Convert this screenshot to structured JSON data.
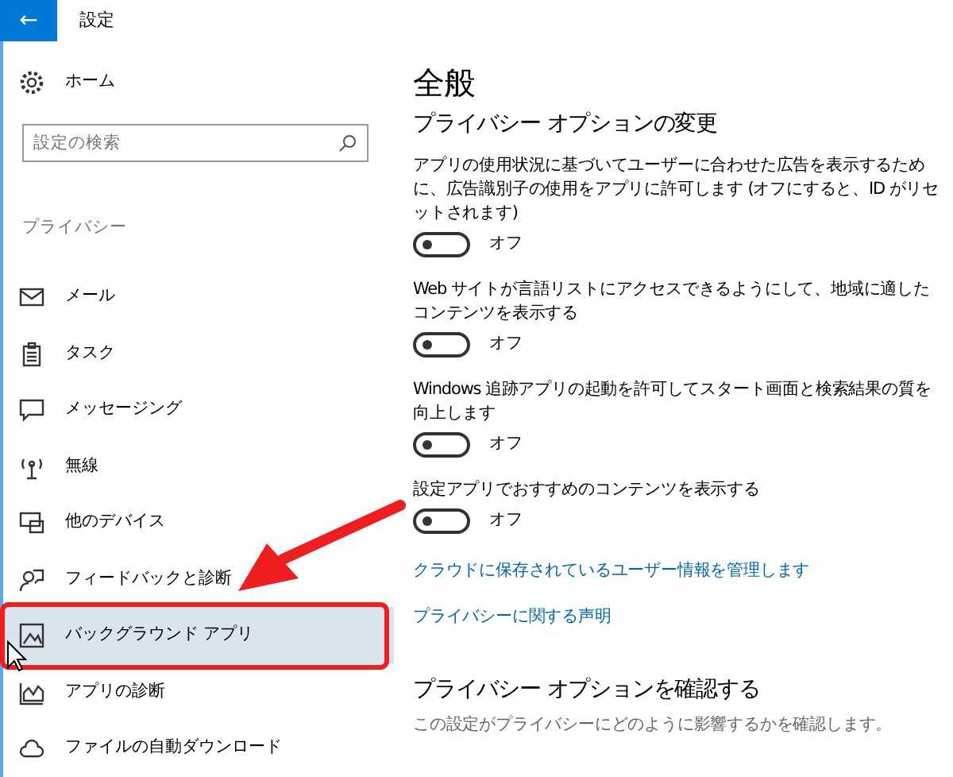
{
  "window": {
    "title": "設定",
    "back": "←"
  },
  "sidebar": {
    "home": "ホーム",
    "search": {
      "placeholder": "設定の検索"
    },
    "section": "プライバシー",
    "items": [
      {
        "label": "メール",
        "selected": false
      },
      {
        "label": "タスク",
        "selected": false
      },
      {
        "label": "メッセージング",
        "selected": false
      },
      {
        "label": "無線",
        "selected": false
      },
      {
        "label": "他のデバイス",
        "selected": false
      },
      {
        "label": "フィードバックと診断",
        "selected": false
      },
      {
        "label": "バックグラウンド アプリ",
        "selected": true
      },
      {
        "label": "アプリの診断",
        "selected": false
      },
      {
        "label": "ファイルの自動ダウンロード",
        "selected": false
      }
    ]
  },
  "content": {
    "title": "全般",
    "subtitle": "プライバシー オプションの変更",
    "options": [
      {
        "text": "アプリの使用状況に基づいてユーザーに合わせた広告を表示するために、広告識別子の使用をアプリに許可します (オフにすると、ID がリセットされます)",
        "on": false,
        "state": "オフ"
      },
      {
        "text": "Web サイトが言語リストにアクセスできるようにして、地域に適したコンテンツを表示する",
        "on": false,
        "state": "オフ"
      },
      {
        "text": "Windows 追跡アプリの起動を許可してスタート画面と検索結果の質を向上します",
        "on": false,
        "state": "オフ"
      },
      {
        "text": "設定アプリでおすすめのコンテンツを表示する",
        "on": false,
        "state": "オフ"
      }
    ],
    "links": [
      "クラウドに保存されているユーザー情報を管理します",
      "プライバシーに関する声明"
    ],
    "section2": {
      "title": "プライバシー オプションを確認する",
      "text": "この設定がプライバシーにどのように影響するかを確認します。"
    }
  }
}
